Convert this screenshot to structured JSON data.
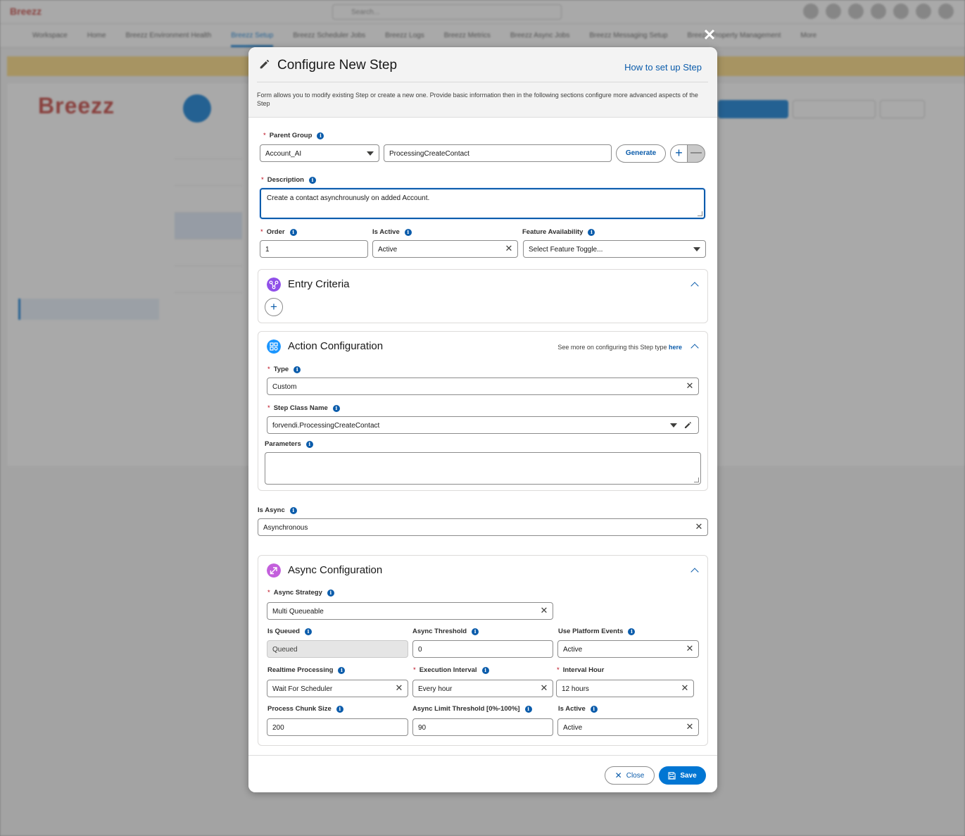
{
  "background": {
    "app_name": "Breezz",
    "search_placeholder": "Search...",
    "nav_items": [
      "Workspace",
      "Home",
      "Breezz Environment Health",
      "Breezz Setup",
      "Breezz Scheduler Jobs",
      "Breezz Logs",
      "Breezz Metrics",
      "Breezz Async Jobs",
      "Breezz Messaging Setup",
      "Breezz Property Management",
      "More"
    ],
    "nav_active_index": 3
  },
  "modal": {
    "close_icon": "close-icon",
    "title": "Configure New Step",
    "title_icon": "pencil-icon",
    "how_to_link": "How to set up Step",
    "description": "Form allows you to modify existing Step or create a new one. Provide basic information then in the following sections configure more advanced aspects of the Step"
  },
  "form": {
    "parent_group": {
      "label": "Parent Group",
      "value": "Account_AI",
      "name_value": "ProcessingCreateContact"
    },
    "generate_label": "Generate",
    "plus_label": "+",
    "minus_label": "—",
    "description": {
      "label": "Description",
      "value": "Create a contact asynchrounusly on added Account."
    },
    "order": {
      "label": "Order",
      "value": "1"
    },
    "is_active": {
      "label": "Is Active",
      "value": "Active"
    },
    "feature_availability": {
      "label": "Feature Availability",
      "placeholder": "Select Feature Toggle..."
    }
  },
  "entry_criteria": {
    "title": "Entry Criteria",
    "add_label": "+"
  },
  "action_configuration": {
    "title": "Action Configuration",
    "see_more_text": "See more on configuring this Step type",
    "see_more_link": "here",
    "type": {
      "label": "Type",
      "value": "Custom"
    },
    "step_class_name": {
      "label": "Step Class Name",
      "value": "forvendi.ProcessingCreateContact"
    },
    "parameters": {
      "label": "Parameters",
      "value": ""
    }
  },
  "is_async": {
    "label": "Is Async",
    "value": "Asynchronous"
  },
  "async_configuration": {
    "title": "Async Configuration",
    "async_strategy": {
      "label": "Async Strategy",
      "value": "Multi Queueable"
    },
    "is_queued": {
      "label": "Is Queued",
      "value": "Queued"
    },
    "async_threshold": {
      "label": "Async Threshold",
      "value": "0"
    },
    "use_platform_events": {
      "label": "Use Platform Events",
      "value": "Active"
    },
    "realtime_processing": {
      "label": "Realtime Processing",
      "value": "Wait For Scheduler"
    },
    "execution_interval": {
      "label": "Execution Interval",
      "value": "Every hour"
    },
    "interval_hour": {
      "label": "Interval Hour",
      "value": "12 hours"
    },
    "process_chunk_size": {
      "label": "Process Chunk Size",
      "value": "200"
    },
    "async_limit_threshold": {
      "label": "Async Limit Threshold [0%-100%]",
      "value": "90"
    },
    "is_active": {
      "label": "Is Active",
      "value": "Active"
    }
  },
  "footer": {
    "close_label": "Close",
    "save_label": "Save"
  },
  "colors": {
    "brand": "#0176d3",
    "link": "#0b5cab",
    "required": "#ba0517",
    "entry_icon": "#9050e9",
    "action_icon": "#1b96ff",
    "async_icon": "#c35fdc"
  }
}
